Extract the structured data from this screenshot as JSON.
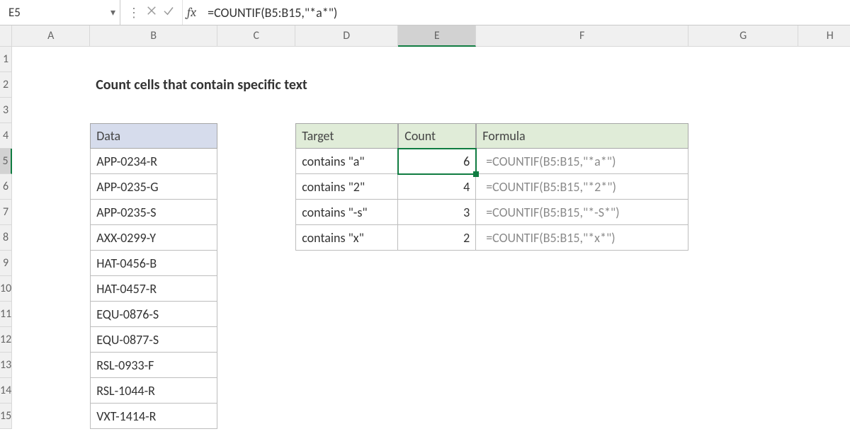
{
  "nameBox": {
    "value": "E5"
  },
  "formulaBar": {
    "fxLabel": "fx",
    "formula": "=COUNTIF(B5:B15,\"*a*\")"
  },
  "columns": [
    "A",
    "B",
    "C",
    "D",
    "E",
    "F",
    "G",
    "H"
  ],
  "rows": [
    "1",
    "2",
    "3",
    "4",
    "5",
    "6",
    "7",
    "8",
    "9",
    "10",
    "11",
    "12",
    "13",
    "14",
    "15"
  ],
  "selectedCol": "E",
  "selectedRow": "5",
  "title": "Count cells that contain specific text",
  "dataHeader": "Data",
  "targetHeader": "Target",
  "countHeader": "Count",
  "formulaHeader": "Formula",
  "data": [
    "APP-0234-R",
    "APP-0235-G",
    "APP-0235-S",
    "AXX-0299-Y",
    "HAT-0456-B",
    "HAT-0457-R",
    "EQU-0876-S",
    "EQU-0877-S",
    "RSL-0933-F",
    "RSL-1044-R",
    "VXT-1414-R"
  ],
  "results": [
    {
      "target": "contains \"a\"",
      "count": "6",
      "formula": "=COUNTIF(B5:B15,\"*a*\")"
    },
    {
      "target": "contains \"2\"",
      "count": "4",
      "formula": "=COUNTIF(B5:B15,\"*2*\")"
    },
    {
      "target": "contains \"-s\"",
      "count": "3",
      "formula": "=COUNTIF(B5:B15,\"*-S*\")"
    },
    {
      "target": "contains \"x\"",
      "count": "2",
      "formula": "=COUNTIF(B5:B15,\"*x*\")"
    }
  ],
  "chart_data": {
    "type": "table",
    "title": "Count cells that contain specific text",
    "columns": [
      "Target",
      "Count",
      "Formula"
    ],
    "rows": [
      [
        "contains \"a\"",
        6,
        "=COUNTIF(B5:B15,\"*a*\")"
      ],
      [
        "contains \"2\"",
        4,
        "=COUNTIF(B5:B15,\"*2*\")"
      ],
      [
        "contains \"-s\"",
        3,
        "=COUNTIF(B5:B15,\"*-S*\")"
      ],
      [
        "contains \"x\"",
        2,
        "=COUNTIF(B5:B15,\"*x*\")"
      ]
    ]
  }
}
